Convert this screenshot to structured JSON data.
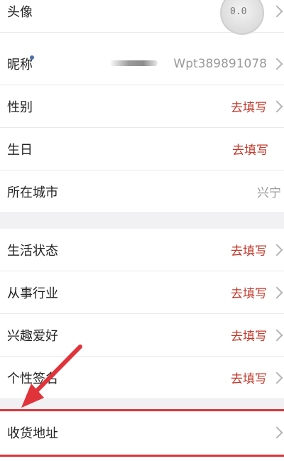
{
  "profile_rows": [
    {
      "label": "头像",
      "value": "",
      "value_color": "none"
    },
    {
      "label": "昵称",
      "value": "Wpt389891078",
      "value_color": "gray"
    },
    {
      "label": "性别",
      "value": "去填写",
      "value_color": "red"
    },
    {
      "label": "生日",
      "value": "去填写",
      "value_color": "red"
    },
    {
      "label": "所在城市",
      "value": "兴宁",
      "value_color": "gray"
    }
  ],
  "extra_rows": [
    {
      "label": "生活状态",
      "value": "去填写",
      "value_color": "red"
    },
    {
      "label": "从事行业",
      "value": "去填写",
      "value_color": "red"
    },
    {
      "label": "兴趣爱好",
      "value": "去填写",
      "value_color": "red"
    },
    {
      "label": "个性签名",
      "value": "去填写",
      "value_color": "red"
    }
  ],
  "address_row": {
    "label": "收货地址"
  },
  "avatar": {
    "face_text": "0.0",
    "icon": "avatar-icon"
  },
  "icons": {
    "chevron": "chevron-right-icon",
    "annotation_arrow": "red-arrow-annotation"
  },
  "colors": {
    "accent_red": "#c0392b",
    "highlight_red": "#e0333a",
    "section_bg": "#f1f1f3"
  }
}
